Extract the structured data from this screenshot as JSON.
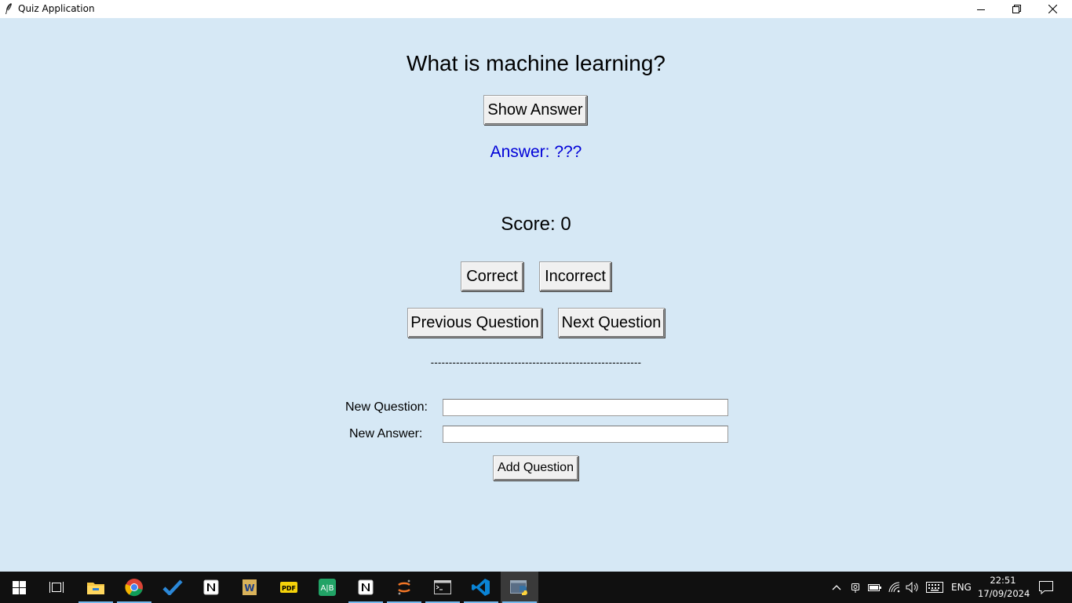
{
  "window": {
    "title": "Quiz Application"
  },
  "quiz": {
    "question": "What is machine learning?",
    "show_answer_label": "Show Answer",
    "answer_text": "Answer: ???",
    "score_text": "Score: 0",
    "correct_label": "Correct",
    "incorrect_label": "Incorrect",
    "previous_label": "Previous Question",
    "next_label": "Next Question",
    "separator": "----------------------------------------------------------",
    "answer_color": "#0000d8"
  },
  "form": {
    "new_question_label": "New Question:",
    "new_question_value": "",
    "new_answer_label": "New Answer:",
    "new_answer_value": "",
    "add_question_label": "Add Question"
  },
  "taskbar": {
    "apps": [
      "start-icon",
      "task-view-icon",
      "file-explorer-icon",
      "chrome-icon",
      "todo-icon",
      "notion-icon",
      "word-icon",
      "pdf-icon",
      "sheets-icon",
      "notion-icon",
      "jupyter-icon",
      "terminal-icon",
      "vscode-icon",
      "python-tk-icon"
    ],
    "language": "ENG",
    "time": "22:51",
    "date": "17/09/2024"
  },
  "colors": {
    "background": "#d6e8f5",
    "taskbar": "#101010",
    "active_indicator": "#76b9ed"
  }
}
